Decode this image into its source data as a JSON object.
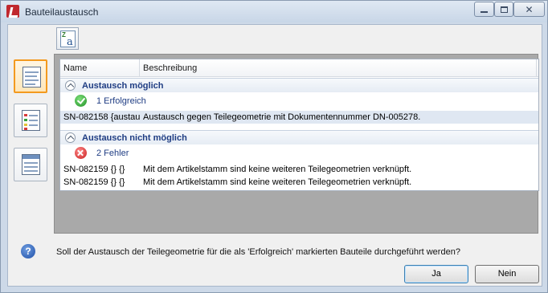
{
  "window": {
    "title": "Bauteilaustausch",
    "close_glyph": "✕"
  },
  "toolbar": {
    "export_icon": "excel-export-icon"
  },
  "sidebar": {
    "items": [
      {
        "icon": "list-view-icon",
        "active": true
      },
      {
        "icon": "table-view-icon",
        "active": false
      },
      {
        "icon": "grid-view-icon",
        "active": false
      }
    ]
  },
  "list": {
    "columns": [
      "Name",
      "Beschreibung"
    ],
    "groups": [
      {
        "title": "Austausch möglich",
        "status": {
          "type": "success",
          "text": "1 Erfolgreich"
        },
        "rows": [
          {
            "name": "SN-082158 {austau",
            "description": "Austausch gegen Teilegeometrie mit Dokumentennummer DN-005278."
          }
        ]
      },
      {
        "title": "Austausch nicht möglich",
        "status": {
          "type": "error",
          "text": "2 Fehler"
        },
        "rows": [
          {
            "name": "SN-082159 {} {}",
            "description": "Mit dem Artikelstamm sind keine weiteren Teilegeometrien verknüpft."
          },
          {
            "name": "SN-082159 {} {}",
            "description": "Mit dem Artikelstamm sind keine weiteren Teilegeometrien verknüpft."
          }
        ]
      }
    ]
  },
  "footer": {
    "question": "Soll der Austausch der Teilegeometrie für die als 'Erfolgreich' markierten Bauteile durchgeführt werden?",
    "question_glyph": "?",
    "yes_label": "Ja",
    "no_label": "Nein"
  },
  "colors": {
    "accent": "#f39a1f",
    "group_title": "#1f3d83",
    "selection": "#dfe7f2"
  }
}
